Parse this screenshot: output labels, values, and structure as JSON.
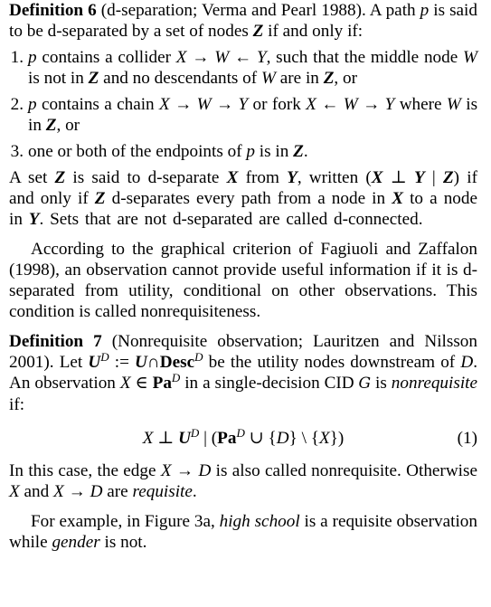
{
  "def6": {
    "label": "Definition 6",
    "intro": "(d-separation; Verma and Pearl 1988). A path p is said to be d-separated by a set of nodes Z if and only if:"
  },
  "conditions": [
    {
      "num": "1.",
      "text": "p contains a collider X → W ← Y, such that the middle node W is not in Z and no descendants of W are in Z, or"
    },
    {
      "num": "2.",
      "text": "p contains a chain X → W → Y or fork X ← W → Y where W is in Z, or"
    },
    {
      "num": "3.",
      "text": "one or both of the endpoints of p is in Z."
    }
  ],
  "dsep_paragraph": "A set Z is said to d-separate X from Y, written (X ⊥ Y | Z) if and only if Z d-separates every path from a node in X to a node in Y. Sets that are not d-separated are called d-connected.",
  "criterion_paragraph": "According to the graphical criterion of Fagiuoli and Zaffalon (1998), an observation cannot provide useful information if it is d-separated from utility, conditional on other observations. This condition is called nonrequisiteness.",
  "def7": {
    "label": "Definition 7",
    "intro": "(Nonrequisite observation; Lauritzen and Nilsson 2001). Let U^D := U ∩ Desc^D be the utility nodes downstream of D. An observation X ∈ Pa^D in a single-decision CID G is nonrequisite if:"
  },
  "equation": {
    "text": "X ⊥ U^D | (Pa^D ∪ {D} \\ {X})",
    "number": "(1)"
  },
  "after_eq": "In this case, the edge X → D is also called nonrequisite. Otherwise X and X → D are requisite.",
  "example_paragraph": "For example, in Figure 3a, high school is a requisite observation while gender is not."
}
